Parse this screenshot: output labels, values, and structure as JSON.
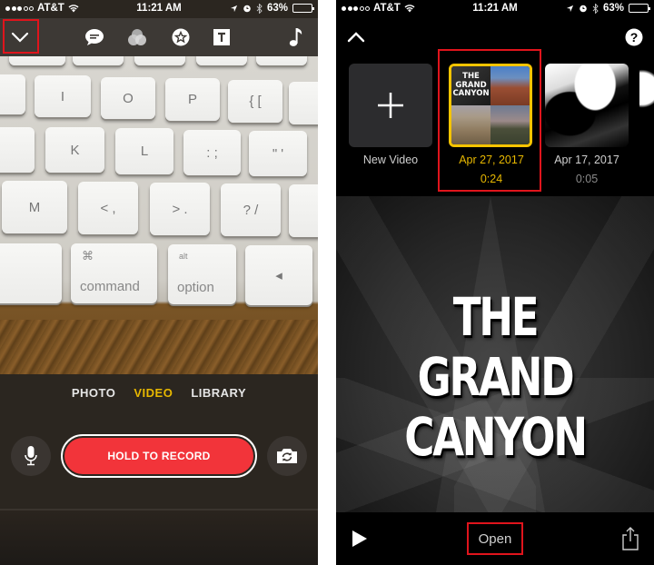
{
  "status_bar": {
    "carrier": "AT&T",
    "signal_bars_filled": 3,
    "signal_bars_total": 5,
    "time": "11:21 AM",
    "battery": "63%",
    "battery_level": 0.63
  },
  "left_screen": {
    "toolbar": {
      "icons": [
        "chevron-down-icon",
        "speech-bubble-icon",
        "filters-icon",
        "star-sticker-icon",
        "text-icon",
        "music-note-icon"
      ],
      "highlighted": "chevron-down-icon"
    },
    "camera_view": {
      "keys": {
        "i": "I",
        "o": "O",
        "p": "P",
        "bracket": "{ [",
        "k": "K",
        "l": "L",
        "semicolon": ": ;",
        "quote": "\" '",
        "m": "M",
        "comma": "< ,",
        "period": "> .",
        "slash": "? /",
        "command_symbol": "⌘",
        "command": "command",
        "alt": "alt",
        "option": "option",
        "arrow": "◂"
      }
    },
    "modes": [
      "PHOTO",
      "VIDEO",
      "LIBRARY"
    ],
    "active_mode": "VIDEO",
    "record_button": "HOLD TO RECORD",
    "accent_color": "#e8b800",
    "record_color": "#f2343a"
  },
  "right_screen": {
    "nav": {
      "collapse_icon": "chevron-up-icon",
      "help_icon": "?"
    },
    "projects": [
      {
        "label": "New Video",
        "type": "new"
      },
      {
        "label": "Apr 27, 2017",
        "duration": "0:24",
        "thumb_title": "THE GRAND CANYON",
        "selected": true
      },
      {
        "label": "Apr 17, 2017",
        "duration": "0:05",
        "selected": false
      }
    ],
    "preview_title_line1": "THE GRAND",
    "preview_title_line2": "CANYON",
    "thumb_title_line1": "THE GRAND",
    "thumb_title_line2": "CANYON",
    "bottom": {
      "open_label": "Open",
      "play_icon": "play-icon",
      "share_icon": "share-icon"
    },
    "selected_color": "#f5c400",
    "highlight_color": "#e0141c"
  }
}
